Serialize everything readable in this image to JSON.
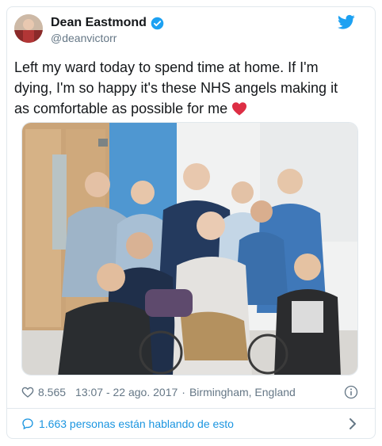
{
  "tweet": {
    "display_name": "Dean Eastmond",
    "handle": "@deanvictorr",
    "verified": true,
    "text": "Left my ward today to spend time at home. If I'm dying, I'm so happy it's these NHS angels making it as comfortable as possible for me",
    "emoji": "red-heart",
    "photo_alt": "",
    "likes": "8.565",
    "timestamp": "13:07 - 22 ago. 2017",
    "separator": "·",
    "location": "Birmingham, England",
    "conversation_link": "1.663 personas están hablando de esto"
  },
  "icons": {
    "brand": "twitter-bird-icon",
    "verified": "verified-badge-icon",
    "like": "heart-outline-icon",
    "info": "info-icon",
    "reply": "speech-bubble-icon",
    "chevron": "chevron-right-icon"
  },
  "colors": {
    "brand_blue": "#1da1f2",
    "link_blue": "#1b95e0",
    "text": "#14171a",
    "muted": "#657786",
    "heart_red": "#e0245e"
  }
}
